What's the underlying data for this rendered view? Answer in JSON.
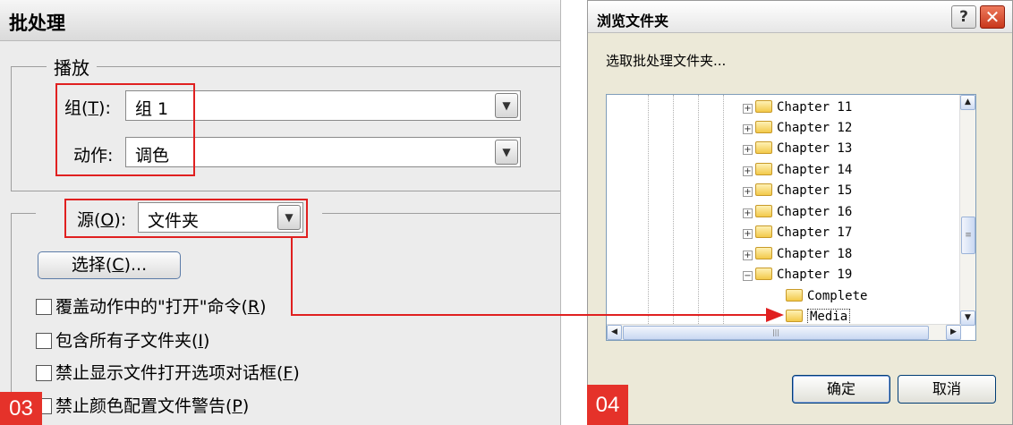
{
  "left_dialog": {
    "title": "批处理",
    "play_legend": "播放",
    "group_label_prefix": "组(",
    "group_label_key": "T",
    "group_label_suffix": "):",
    "group_value": "组 1",
    "action_label": "动作:",
    "action_value": "调色",
    "source_label_prefix": "源(",
    "source_label_key": "O",
    "source_label_suffix": "):",
    "source_value": "文件夹",
    "choose_button_prefix": "选择(",
    "choose_button_key": "C",
    "choose_button_suffix": ")...",
    "checkboxes": [
      {
        "prefix": "覆盖动作中的\"打开\"命令(",
        "key": "R",
        "suffix": ")",
        "checked": false
      },
      {
        "prefix": "包含所有子文件夹(",
        "key": "I",
        "suffix": ")",
        "checked": false
      },
      {
        "prefix": "禁止显示文件打开选项对话框(",
        "key": "F",
        "suffix": ")",
        "checked": false
      },
      {
        "prefix": "禁止颜色配置文件警告(",
        "key": "P",
        "suffix": ")",
        "checked": false
      }
    ],
    "step_badge": "03"
  },
  "right_dialog": {
    "title": "浏览文件夹",
    "help_glyph": "?",
    "close_glyph": "✕",
    "prompt": "选取批处理文件夹...",
    "tree": [
      {
        "label": "Chapter 11",
        "toggle": "+"
      },
      {
        "label": "Chapter 12",
        "toggle": "+"
      },
      {
        "label": "Chapter 13",
        "toggle": "+"
      },
      {
        "label": "Chapter 14",
        "toggle": "+"
      },
      {
        "label": "Chapter 15",
        "toggle": "+"
      },
      {
        "label": "Chapter 16",
        "toggle": "+"
      },
      {
        "label": "Chapter 17",
        "toggle": "+"
      },
      {
        "label": "Chapter 18",
        "toggle": "+"
      },
      {
        "label": "Chapter 19",
        "toggle": "−"
      }
    ],
    "subfolders": [
      "Complete",
      "Media"
    ],
    "selected_subfolder": "Media",
    "ok_label": "确定",
    "cancel_label": "取消",
    "step_badge": "04"
  },
  "colors": {
    "highlight": "#e02020",
    "badge": "#e5322a"
  }
}
